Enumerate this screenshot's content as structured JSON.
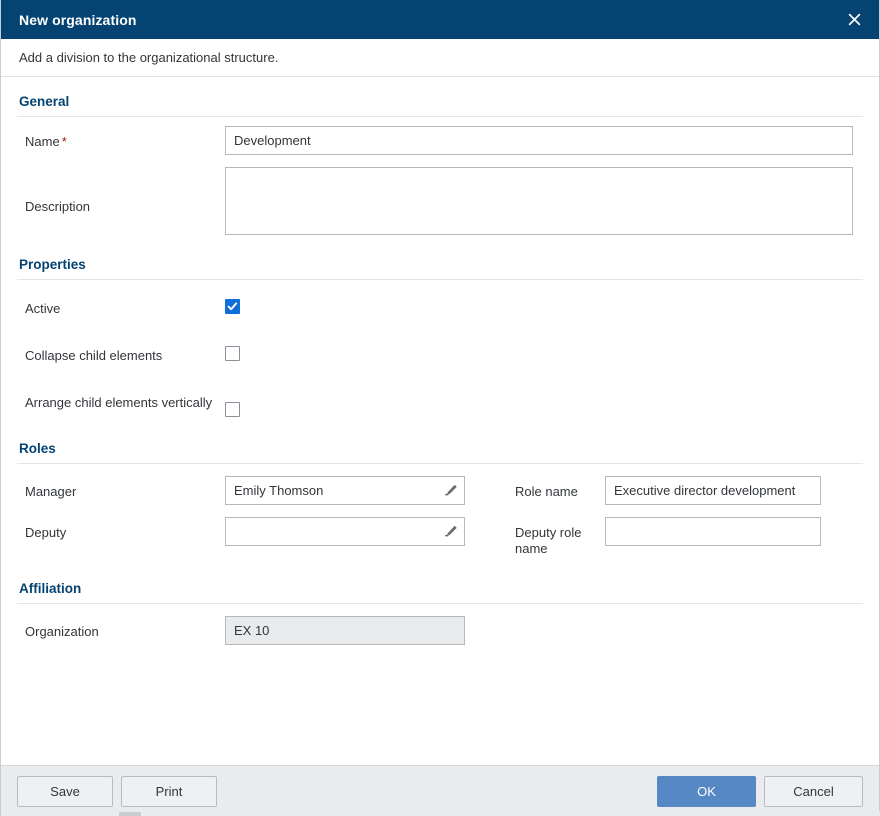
{
  "dialog": {
    "title": "New organization",
    "subtitle": "Add a division to the organizational structure.",
    "close_icon": "close-icon"
  },
  "sections": {
    "general": {
      "header": "General",
      "name_label": "Name",
      "name_required_marker": "*",
      "name_value": "Development",
      "name_placeholder": "",
      "description_label": "Description",
      "description_value": "",
      "description_placeholder": ""
    },
    "properties": {
      "header": "Properties",
      "active_label": "Active",
      "active_checked": "true",
      "collapse_label": "Collapse child elements",
      "collapse_checked": "false",
      "arrange_label": "Arrange child elements vertically",
      "arrange_checked": "false"
    },
    "roles": {
      "header": "Roles",
      "manager_label": "Manager",
      "manager_value": "Emily Thomson",
      "manager_placeholder": "",
      "deputy_label": "Deputy",
      "deputy_value": "",
      "deputy_placeholder": "",
      "role_name_label": "Role name",
      "role_name_value": "Executive director development",
      "role_name_placeholder": "",
      "deputy_role_name_label": "Deputy role name",
      "deputy_role_name_value": "",
      "deputy_role_name_placeholder": "",
      "value_help_icon": "pencil-edit-icon"
    },
    "affiliation": {
      "header": "Affiliation",
      "organization_label": "Organization",
      "organization_value": "EX 10",
      "organization_disabled": "true"
    }
  },
  "footer": {
    "save_label": "Save",
    "print_label": "Print",
    "ok_label": "OK",
    "cancel_label": "Cancel"
  },
  "colors": {
    "titlebar_blue": "#044372",
    "section_header_blue": "#044372",
    "checkbox_blue": "#0f6fd8",
    "primary_button_blue": "#5588c4",
    "required_star_red": "#a1170a",
    "footer_gray": "#eaebed"
  }
}
